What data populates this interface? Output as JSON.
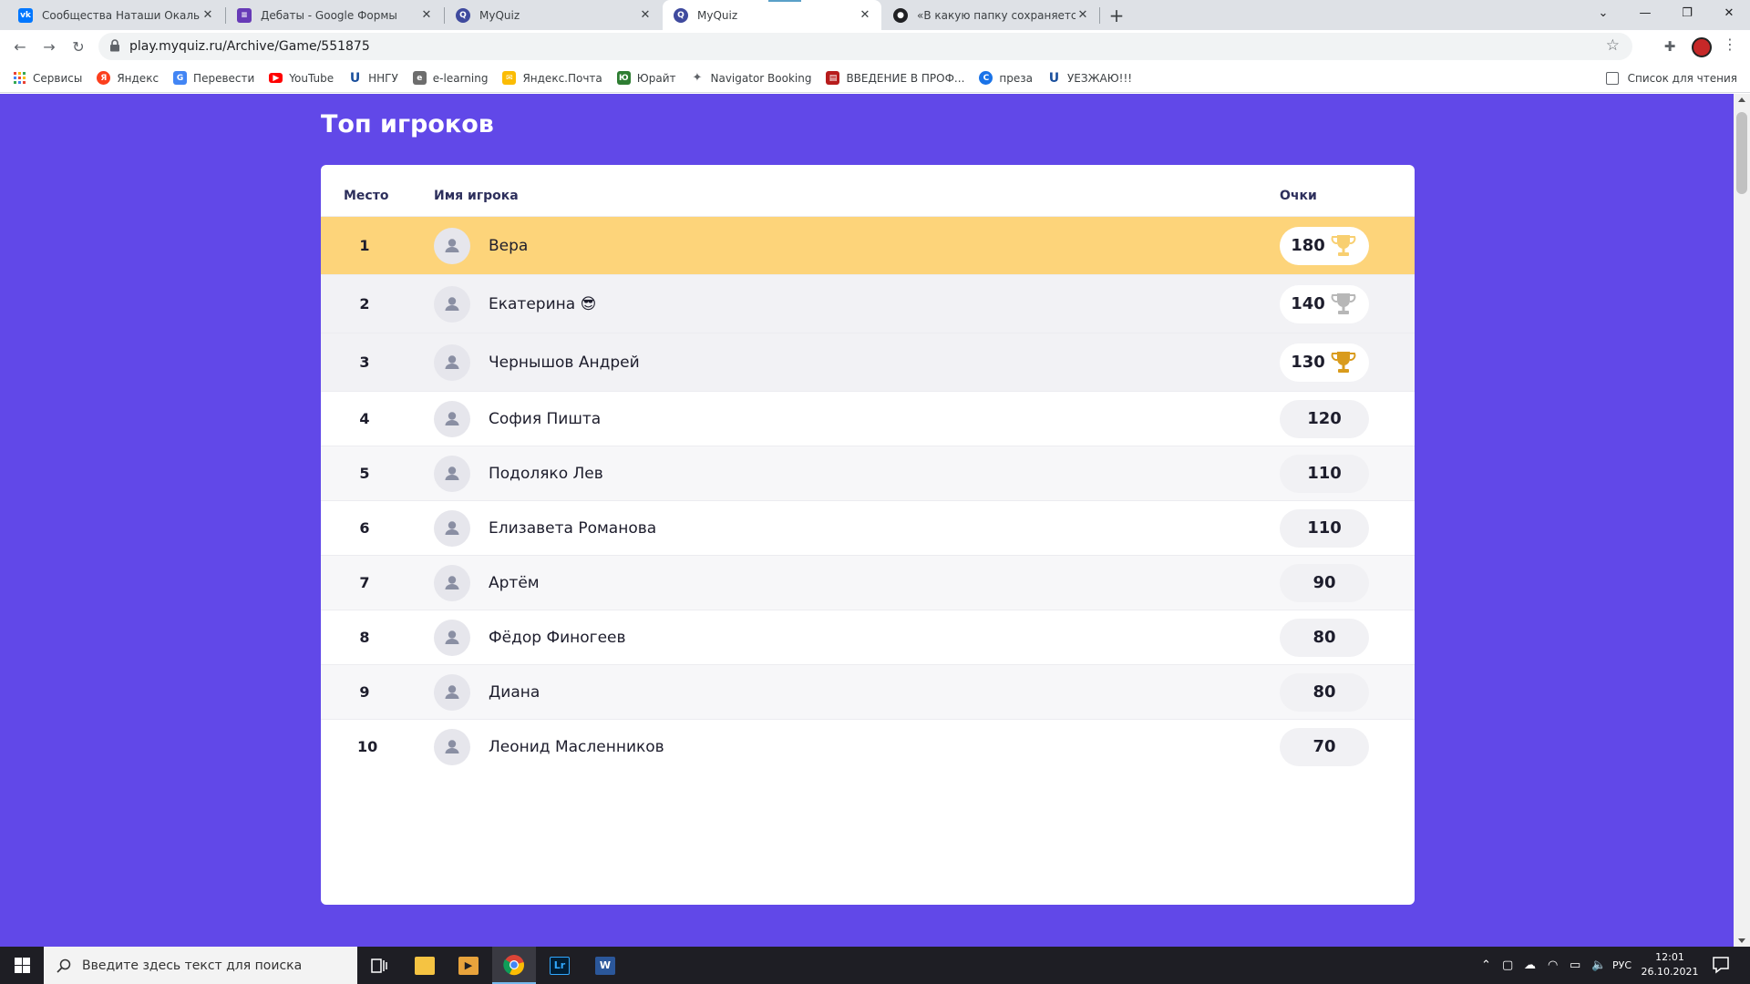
{
  "browser": {
    "tabs": [
      {
        "title": "Сообщества Наташи Окальник",
        "icon": "vk-icon",
        "color": "#0077ff"
      },
      {
        "title": "Дебаты - Google Формы",
        "icon": "google-forms-icon",
        "color": "#673ab7"
      },
      {
        "title": "MyQuiz",
        "icon": "myquiz-icon",
        "color": "#3f4a9e"
      },
      {
        "title": "MyQuiz",
        "icon": "myquiz-icon",
        "color": "#3f4a9e",
        "active": true
      },
      {
        "title": "«В какую папку сохраняется скр",
        "icon": "github-icon",
        "color": "#202124"
      }
    ],
    "url": "play.myquiz.ru/Archive/Game/551875",
    "bookmarks": [
      {
        "label": "Сервисы",
        "icon": "apps-grid-icon",
        "color": "#ea4335"
      },
      {
        "label": "Яндекс",
        "icon": "yandex-icon",
        "color": "#fc3f1d"
      },
      {
        "label": "Перевести",
        "icon": "translate-icon",
        "color": "#4285f4"
      },
      {
        "label": "YouTube",
        "icon": "youtube-icon",
        "color": "#ff0000"
      },
      {
        "label": "ННГУ",
        "icon": "nngu-icon",
        "color": "#1a4f9c"
      },
      {
        "label": "e-learning",
        "icon": "elearning-icon",
        "color": "#6d6d6d"
      },
      {
        "label": "Яндекс.Почта",
        "icon": "mail-icon",
        "color": "#fbbc04"
      },
      {
        "label": "Юрайт",
        "icon": "urait-icon",
        "color": "#2e7d32"
      },
      {
        "label": "Navigator Booking",
        "icon": "navigator-icon",
        "color": "#5f6368"
      },
      {
        "label": "ВВЕДЕНИЕ В ПРОФ...",
        "icon": "document-icon",
        "color": "#b71c1c"
      },
      {
        "label": "преза",
        "icon": "canva-icon",
        "color": "#1a73e8"
      },
      {
        "label": "УЕЗЖАЮ!!!",
        "icon": "nngu-icon",
        "color": "#1a4f9c"
      }
    ],
    "reading_list": "Список для чтения"
  },
  "page": {
    "title": "Топ игроков",
    "columns": {
      "place": "Место",
      "name": "Имя игрока",
      "score": "Очки"
    },
    "colors": {
      "background": "#6148e8",
      "first_row": "#fdd47a",
      "top3_row": "#f2f2f5",
      "gold": "#f8cf70",
      "silver": "#b7b7b7",
      "bronze": "#d99b1c"
    },
    "players": [
      {
        "place": "1",
        "name": "Вера",
        "score": "180",
        "trophy": "gold"
      },
      {
        "place": "2",
        "name": "Екатерина 😎",
        "score": "140",
        "trophy": "silver"
      },
      {
        "place": "3",
        "name": "Чернышов Андрей",
        "score": "130",
        "trophy": "bronze"
      },
      {
        "place": "4",
        "name": "София Пишта",
        "score": "120"
      },
      {
        "place": "5",
        "name": "Подоляко Лев",
        "score": "110"
      },
      {
        "place": "6",
        "name": "Елизавета Романова",
        "score": "110"
      },
      {
        "place": "7",
        "name": "Артём",
        "score": "90"
      },
      {
        "place": "8",
        "name": "Фёдор Финогеев",
        "score": "80"
      },
      {
        "place": "9",
        "name": "Диана",
        "score": "80"
      },
      {
        "place": "10",
        "name": "Леонид Масленников",
        "score": "70"
      }
    ]
  },
  "taskbar": {
    "search_placeholder": "Введите здесь текст для поиска",
    "apps": [
      {
        "name": "task-view-icon"
      },
      {
        "name": "file-explorer-icon",
        "color": "#f5c342"
      },
      {
        "name": "media-player-icon",
        "color": "#e8a33c"
      },
      {
        "name": "chrome-icon",
        "active": true
      },
      {
        "label": "Lr",
        "name": "lightroom-icon",
        "color": "#001e36"
      },
      {
        "label": "W",
        "name": "word-icon",
        "color": "#2b579a"
      }
    ],
    "language": "РУС",
    "time": "12:01",
    "date": "26.10.2021"
  }
}
